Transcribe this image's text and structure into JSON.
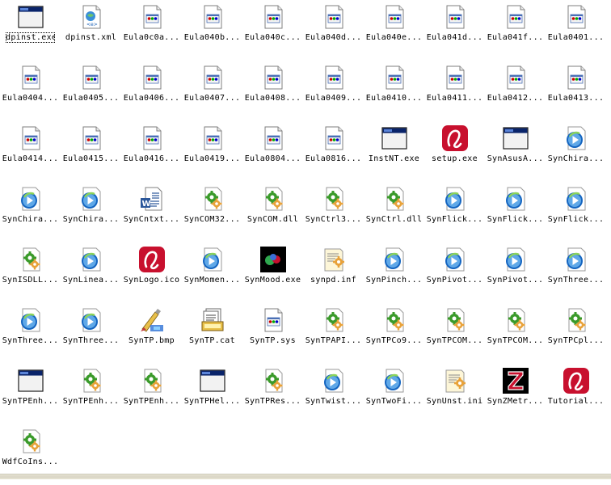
{
  "colors": {
    "window_blue": "#0a246a",
    "doc_border": "#7f7f7f",
    "gear_green": "#3a9a2a",
    "gear_orange": "#e8a23a",
    "media_blue": "#1565c0",
    "logo_red": "#c8102e"
  },
  "files": [
    {
      "label": "dpinst.exe",
      "icon": "window-icon"
    },
    {
      "label": "dpinst.xml",
      "icon": "xml-icon"
    },
    {
      "label": "Eula0c0a...",
      "icon": "document-icon"
    },
    {
      "label": "Eula040b...",
      "icon": "document-icon"
    },
    {
      "label": "Eula040c...",
      "icon": "document-icon"
    },
    {
      "label": "Eula040d...",
      "icon": "document-icon"
    },
    {
      "label": "Eula040e...",
      "icon": "document-icon"
    },
    {
      "label": "Eula041d...",
      "icon": "document-icon"
    },
    {
      "label": "Eula041f...",
      "icon": "document-icon"
    },
    {
      "label": "Eula0401...",
      "icon": "document-icon"
    },
    {
      "label": "Eula0404...",
      "icon": "document-icon"
    },
    {
      "label": "Eula0405...",
      "icon": "document-icon"
    },
    {
      "label": "Eula0406...",
      "icon": "document-icon"
    },
    {
      "label": "Eula0407...",
      "icon": "document-icon"
    },
    {
      "label": "Eula0408...",
      "icon": "document-icon"
    },
    {
      "label": "Eula0409...",
      "icon": "document-icon"
    },
    {
      "label": "Eula0410...",
      "icon": "document-icon"
    },
    {
      "label": "Eula0411...",
      "icon": "document-icon"
    },
    {
      "label": "Eula0412...",
      "icon": "document-icon"
    },
    {
      "label": "Eula0413...",
      "icon": "document-icon"
    },
    {
      "label": "Eula0414...",
      "icon": "document-icon"
    },
    {
      "label": "Eula0415...",
      "icon": "document-icon"
    },
    {
      "label": "Eula0416...",
      "icon": "document-icon"
    },
    {
      "label": "Eula0419...",
      "icon": "document-icon"
    },
    {
      "label": "Eula0804...",
      "icon": "document-icon"
    },
    {
      "label": "Eula0816...",
      "icon": "document-icon"
    },
    {
      "label": "InstNT.exe",
      "icon": "window-icon"
    },
    {
      "label": "setup.exe",
      "icon": "synaptics-logo-icon"
    },
    {
      "label": "SynAsusA...",
      "icon": "window-icon"
    },
    {
      "label": "SynChira...",
      "icon": "media-icon"
    },
    {
      "label": "SynChira...",
      "icon": "media-icon"
    },
    {
      "label": "SynChira...",
      "icon": "media-icon"
    },
    {
      "label": "SynCntxt...",
      "icon": "word-document-icon"
    },
    {
      "label": "SynCOM32...",
      "icon": "gear-file-icon"
    },
    {
      "label": "SynCOM.dll",
      "icon": "gear-file-icon"
    },
    {
      "label": "SynCtrl3...",
      "icon": "gear-file-icon"
    },
    {
      "label": "SynCtrl.dll",
      "icon": "gear-file-icon"
    },
    {
      "label": "SynFlick...",
      "icon": "media-icon"
    },
    {
      "label": "SynFlick...",
      "icon": "media-icon"
    },
    {
      "label": "SynFlick...",
      "icon": "media-icon"
    },
    {
      "label": "SynISDLL...",
      "icon": "gear-file-icon"
    },
    {
      "label": "SynLinea...",
      "icon": "media-icon"
    },
    {
      "label": "SynLogo.ico",
      "icon": "synaptics-logo-icon"
    },
    {
      "label": "SynMomen...",
      "icon": "media-icon"
    },
    {
      "label": "SynMood.exe",
      "icon": "mood-icon"
    },
    {
      "label": "synpd.inf",
      "icon": "inf-icon"
    },
    {
      "label": "SynPinch...",
      "icon": "media-icon"
    },
    {
      "label": "SynPivot...",
      "icon": "media-icon"
    },
    {
      "label": "SynPivot...",
      "icon": "media-icon"
    },
    {
      "label": "SynThree...",
      "icon": "media-icon"
    },
    {
      "label": "SynThree...",
      "icon": "media-icon"
    },
    {
      "label": "SynThree...",
      "icon": "media-icon"
    },
    {
      "label": "SynTP.bmp",
      "icon": "paint-icon"
    },
    {
      "label": "SynTP.cat",
      "icon": "catalog-icon"
    },
    {
      "label": "SynTP.sys",
      "icon": "document-icon"
    },
    {
      "label": "SynTPAPI...",
      "icon": "gear-file-icon"
    },
    {
      "label": "SynTPCo9...",
      "icon": "gear-file-icon"
    },
    {
      "label": "SynTPCOM...",
      "icon": "gear-file-icon"
    },
    {
      "label": "SynTPCOM...",
      "icon": "gear-file-icon"
    },
    {
      "label": "SynTPCpl...",
      "icon": "gear-file-icon"
    },
    {
      "label": "SynTPEnh...",
      "icon": "window-icon"
    },
    {
      "label": "SynTPEnh...",
      "icon": "gear-file-icon"
    },
    {
      "label": "SynTPEnh...",
      "icon": "gear-file-icon"
    },
    {
      "label": "SynTPHel...",
      "icon": "window-icon"
    },
    {
      "label": "SynTPRes...",
      "icon": "gear-file-icon"
    },
    {
      "label": "SynTwist...",
      "icon": "media-icon"
    },
    {
      "label": "SynTwoFi...",
      "icon": "media-icon"
    },
    {
      "label": "SynUnst.ini",
      "icon": "inf-icon"
    },
    {
      "label": "SynZMetr...",
      "icon": "zmetric-icon"
    },
    {
      "label": "Tutorial...",
      "icon": "synaptics-logo-icon"
    },
    {
      "label": "WdfCoIns...",
      "icon": "gear-file-icon"
    }
  ]
}
